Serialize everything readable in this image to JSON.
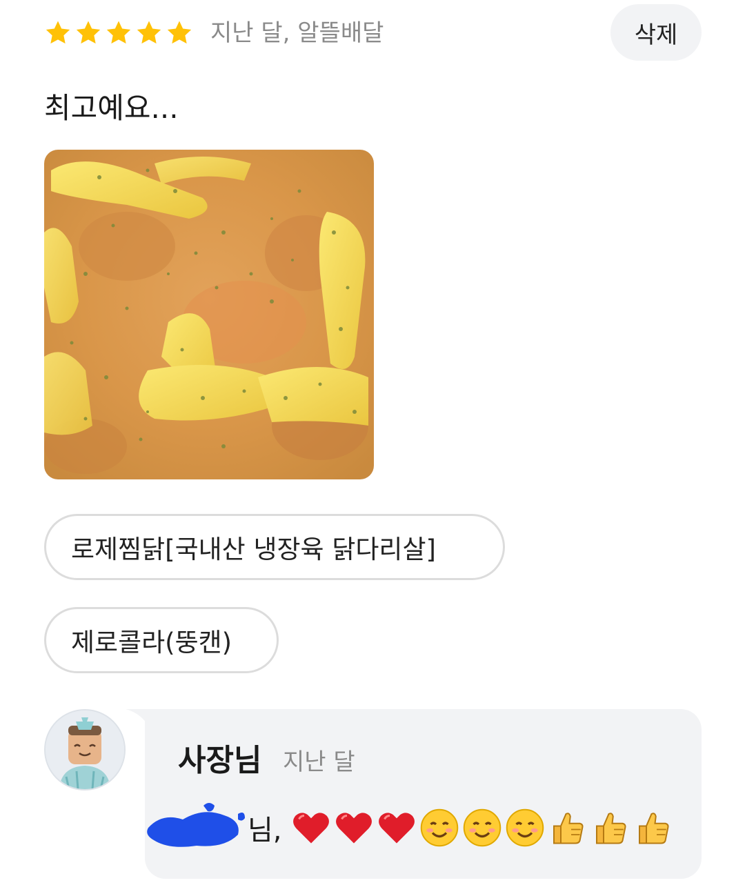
{
  "review": {
    "rating": 5,
    "max_rating": 5,
    "meta": "지난 달, 알뜰배달",
    "delete_label": "삭제",
    "text": "최고예요...",
    "star_color": "#FFC107"
  },
  "menu_items": [
    {
      "label": "로제찜닭[국내산 냉장육 닭다리살]"
    },
    {
      "label": "제로콜라(뚱캔)"
    }
  ],
  "owner_reply": {
    "name": "사장님",
    "time": "지난 달",
    "text": "님,",
    "emojis": [
      "heart-icon",
      "heart-icon",
      "heart-icon",
      "smiling-face-icon",
      "smiling-face-icon",
      "smiling-face-icon",
      "thumbs-up-icon",
      "thumbs-up-icon",
      "thumbs-up-icon"
    ]
  }
}
